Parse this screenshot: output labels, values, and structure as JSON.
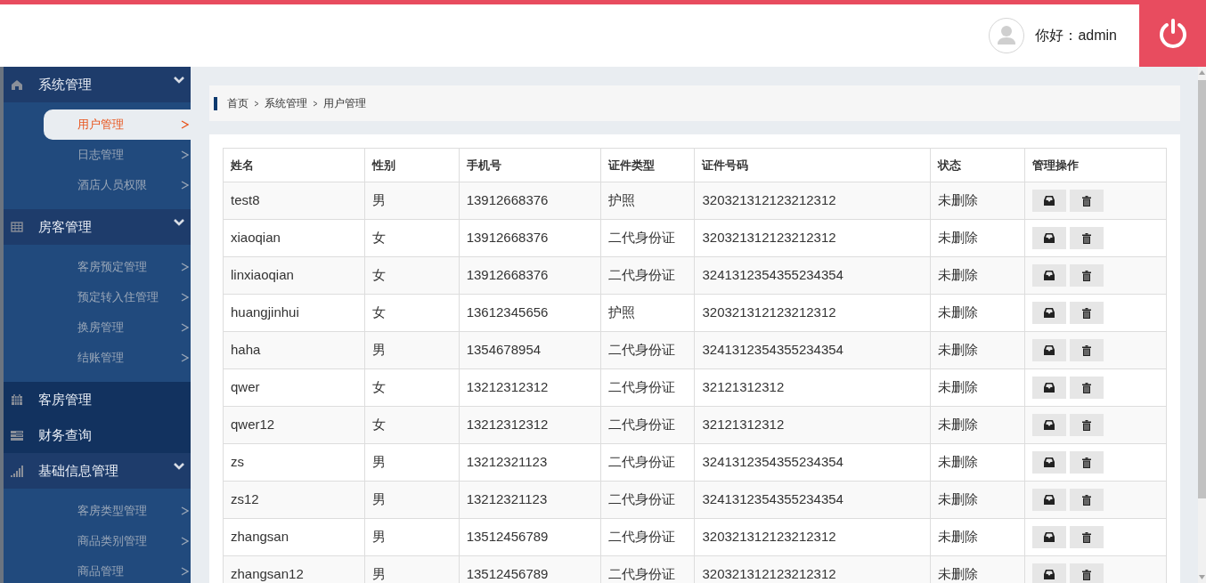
{
  "header": {
    "greeting": "你好：admin"
  },
  "sidebar": {
    "groups": [
      {
        "label": "系统管理",
        "expanded": true,
        "children": [
          {
            "label": "用户管理",
            "selected": true
          },
          {
            "label": "日志管理",
            "selected": false
          },
          {
            "label": "酒店人员权限",
            "selected": false
          }
        ]
      },
      {
        "label": "房客管理",
        "expanded": true,
        "children": [
          {
            "label": "客房预定管理",
            "selected": false
          },
          {
            "label": "预定转入住管理",
            "selected": false
          },
          {
            "label": "换房管理",
            "selected": false
          },
          {
            "label": "结账管理",
            "selected": false
          }
        ]
      },
      {
        "label": "客房管理",
        "expanded": false
      },
      {
        "label": "财务查询",
        "expanded": false
      },
      {
        "label": "基础信息管理",
        "expanded": true,
        "children": [
          {
            "label": "客房类型管理",
            "selected": false
          },
          {
            "label": "商品类别管理",
            "selected": false
          },
          {
            "label": "商品管理",
            "selected": false
          }
        ]
      }
    ]
  },
  "breadcrumb": [
    "首页",
    "系统管理",
    "用户管理"
  ],
  "table": {
    "columns": [
      "姓名",
      "性别",
      "手机号",
      "证件类型",
      "证件号码",
      "状态",
      "管理操作"
    ],
    "rows": [
      [
        "test8",
        "男",
        "13912668376",
        "护照",
        "320321312123212312",
        "未删除"
      ],
      [
        "xiaoqian",
        "女",
        "13912668376",
        "二代身份证",
        "320321312123212312",
        "未删除"
      ],
      [
        "linxiaoqian",
        "女",
        "13912668376",
        "二代身份证",
        "3241312354355234354",
        "未删除"
      ],
      [
        "huangjinhui",
        "女",
        "13612345656",
        "护照",
        "320321312123212312",
        "未删除"
      ],
      [
        "haha",
        "男",
        "1354678954",
        "二代身份证",
        "3241312354355234354",
        "未删除"
      ],
      [
        "qwer",
        "女",
        "13212312312",
        "二代身份证",
        "32121312312",
        "未删除"
      ],
      [
        "qwer12",
        "女",
        "13212312312",
        "二代身份证",
        "32121312312",
        "未删除"
      ],
      [
        "zs",
        "男",
        "13212321123",
        "二代身份证",
        "3241312354355234354",
        "未删除"
      ],
      [
        "zs12",
        "男",
        "13212321123",
        "二代身份证",
        "3241312354355234354",
        "未删除"
      ],
      [
        "zhangsan",
        "男",
        "13512456789",
        "二代身份证",
        "320321312123212312",
        "未删除"
      ],
      [
        "zhangsan12",
        "男",
        "13512456789",
        "二代身份证",
        "320321312123212312",
        "未删除"
      ]
    ]
  }
}
